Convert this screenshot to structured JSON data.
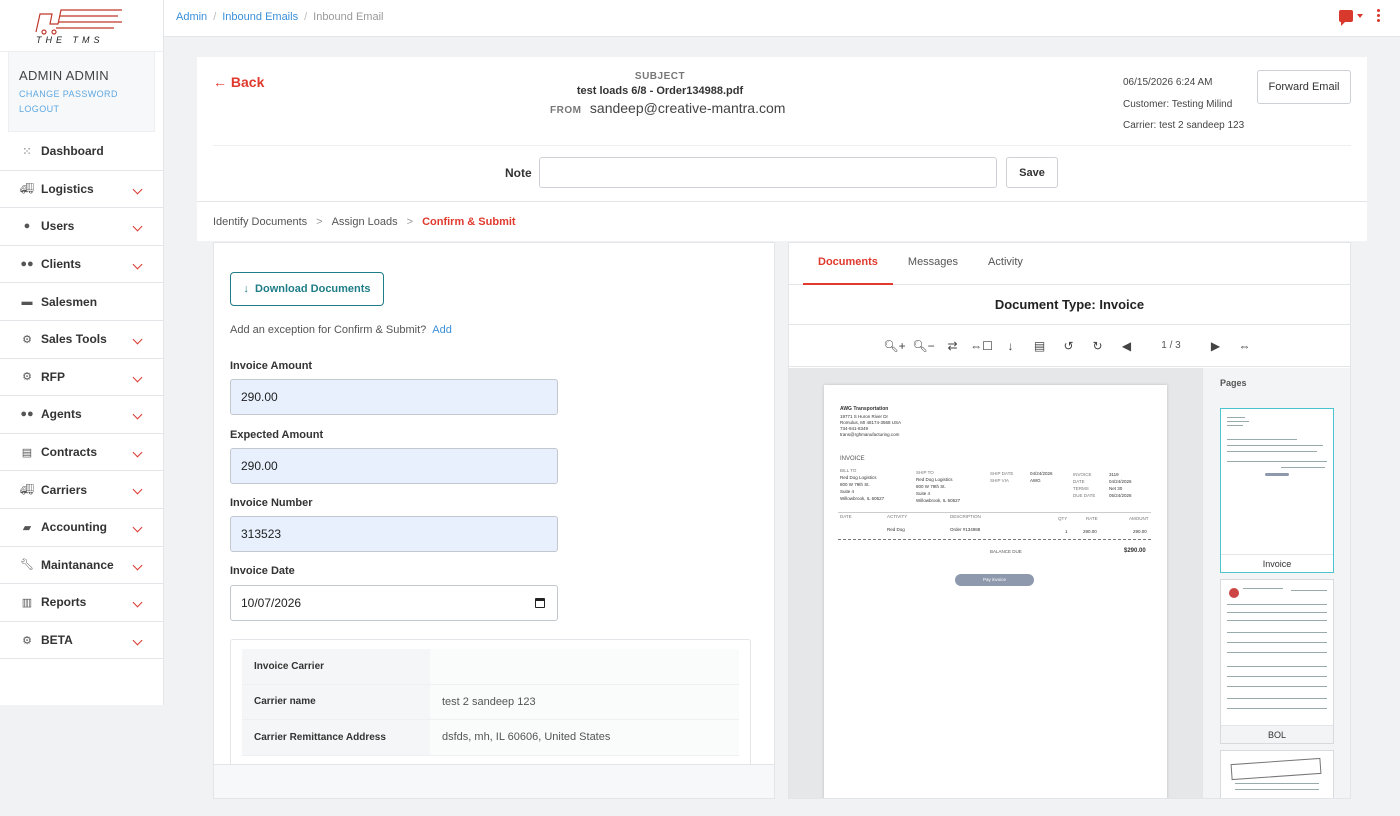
{
  "app": {
    "logo_text": "THE TMS"
  },
  "user": {
    "name": "ADMIN ADMIN",
    "change_password": "CHANGE PASSWORD",
    "logout": "LOGOUT"
  },
  "sidebar": {
    "items": [
      {
        "label": "Dashboard",
        "icon": "dashboard-icon",
        "expandable": false
      },
      {
        "label": "Logistics",
        "icon": "truck-icon",
        "expandable": true
      },
      {
        "label": "Users",
        "icon": "user-icon",
        "expandable": true
      },
      {
        "label": "Clients",
        "icon": "users-group-icon",
        "expandable": true
      },
      {
        "label": "Salesmen",
        "icon": "briefcase-icon",
        "expandable": false
      },
      {
        "label": "Sales Tools",
        "icon": "gears-icon",
        "expandable": true
      },
      {
        "label": "RFP",
        "icon": "gears-icon",
        "expandable": true
      },
      {
        "label": "Agents",
        "icon": "people-icon",
        "expandable": true
      },
      {
        "label": "Contracts",
        "icon": "documents-icon",
        "expandable": true
      },
      {
        "label": "Carriers",
        "icon": "truck-icon",
        "expandable": true
      },
      {
        "label": "Accounting",
        "icon": "book-icon",
        "expandable": true
      },
      {
        "label": "Maintanance",
        "icon": "wrench-icon",
        "expandable": true
      },
      {
        "label": "Reports",
        "icon": "bar-chart-icon",
        "expandable": true
      },
      {
        "label": "BETA",
        "icon": "gears-icon",
        "expandable": true
      }
    ]
  },
  "breadcrumb": {
    "items": [
      "Admin",
      "Inbound Emails"
    ],
    "current": "Inbound Email"
  },
  "header": {
    "back_label": "← Back",
    "subject_label": "SUBJECT",
    "subject": "test loads 6/8 - Order134988.pdf",
    "from_label": "FROM",
    "from": "sandeep@creative-mantra.com",
    "datetime": "06/15/2026 6:24 AM",
    "customer": "Customer: Testing Milind",
    "carrier": "Carrier: test 2 sandeep 123",
    "forward_label": "Forward Email",
    "note_label": "Note",
    "note_value": "",
    "save_label": "Save"
  },
  "steps": {
    "items": [
      "Identify Documents",
      "Assign Loads"
    ],
    "active": "Confirm & Submit",
    "separator": ">"
  },
  "form": {
    "download_label": "Download Documents",
    "exception_text": "Add an exception for Confirm & Submit?",
    "exception_link": "Add",
    "invoice_amount_label": "Invoice Amount",
    "invoice_amount": "290.00",
    "expected_amount_label": "Expected Amount",
    "expected_amount": "290.00",
    "invoice_number_label": "Invoice Number",
    "invoice_number": "313523",
    "invoice_date_label": "Invoice Date",
    "invoice_date": "10/07/2026",
    "carrier_rows": [
      {
        "key": "Invoice Carrier",
        "value": ""
      },
      {
        "key": "Carrier name",
        "value": "test 2 sandeep 123"
      },
      {
        "key": "Carrier Remittance Address",
        "value": "dsfds, mh, IL 60606, United States"
      }
    ]
  },
  "viewer": {
    "tabs": [
      "Documents",
      "Messages",
      "Activity"
    ],
    "active_tab": "Documents",
    "doc_type": "Document Type: Invoice",
    "page_indicator": "1 / 3",
    "pages_label": "Pages",
    "thumbnails": [
      "Invoice",
      "BOL"
    ],
    "document": {
      "company": "AWG Transportation",
      "addr1": "19771 S Huron River Dr",
      "addr2": "Romulus, MI 48174-3568 USA",
      "phone": "734-941-8349",
      "email": "trans@rghmanufacturing.com",
      "title": "INVOICE",
      "bill_to_label": "BILL TO",
      "bill_to": [
        "Red Dog Logistics",
        "800 W 79th St.",
        "Suite 4",
        "Willowbrook, IL 60527"
      ],
      "ship_to_label": "SHIP TO",
      "ship_to": [
        "Red Dog Logistics",
        "800 W 79th St.",
        "Suite 4",
        "Willowbrook, IL 60527"
      ],
      "ship_date_label": "SHIP DATE",
      "ship_date": "04/24/2026",
      "ship_via_label": "SHIP VIA",
      "ship_via": "AWG",
      "invoice_label": "INVOICE",
      "invoice_no": "3119",
      "date_label": "DATE",
      "date": "04/24/2026",
      "terms_label": "TERMS",
      "terms": "Net 30",
      "due_label": "DUE DATE",
      "due": "05/24/2026",
      "cols": [
        "DATE",
        "ACTIVITY",
        "DESCRIPTION",
        "QTY",
        "RATE",
        "AMOUNT"
      ],
      "line": {
        "activity": "Red Dog",
        "description": "Order #134988",
        "qty": "1",
        "rate": "290.00",
        "amount": "290.00"
      },
      "balance_label": "BALANCE DUE",
      "balance": "$290.00",
      "pay_label": "Pay invoice"
    }
  }
}
